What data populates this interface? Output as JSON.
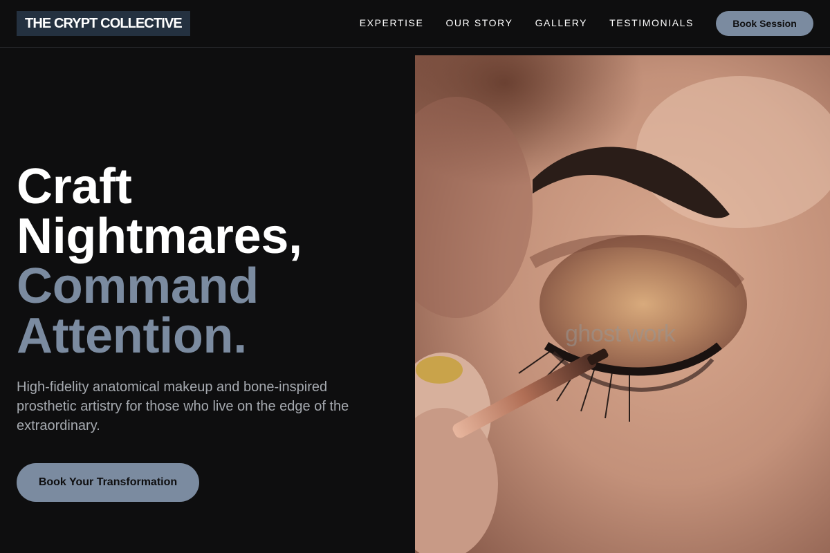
{
  "brand": {
    "name": "THE CRYPT COLLECTIVE"
  },
  "nav": {
    "links": [
      "EXPERTISE",
      "OUR STORY",
      "GALLERY",
      "TESTIMONIALS"
    ],
    "cta_label": "Book Session"
  },
  "hero": {
    "headline_line1": "Craft",
    "headline_line2": "Nightmares,",
    "headline_line3": "Command",
    "headline_line4": "Attention.",
    "subtitle": "High-fidelity anatomical makeup and bone-inspired prosthetic artistry for those who live on the edge of the extraordinary.",
    "cta_label": "Book Your Transformation",
    "image": {
      "subject": "close-up of eye makeup being applied with a brush",
      "watermark": "ghost work"
    }
  },
  "colors": {
    "background": "#0e0e0f",
    "accent": "#7b8ba0",
    "logo_bg": "#243140",
    "text_primary": "#ffffff",
    "text_secondary": "#a6aab0"
  }
}
